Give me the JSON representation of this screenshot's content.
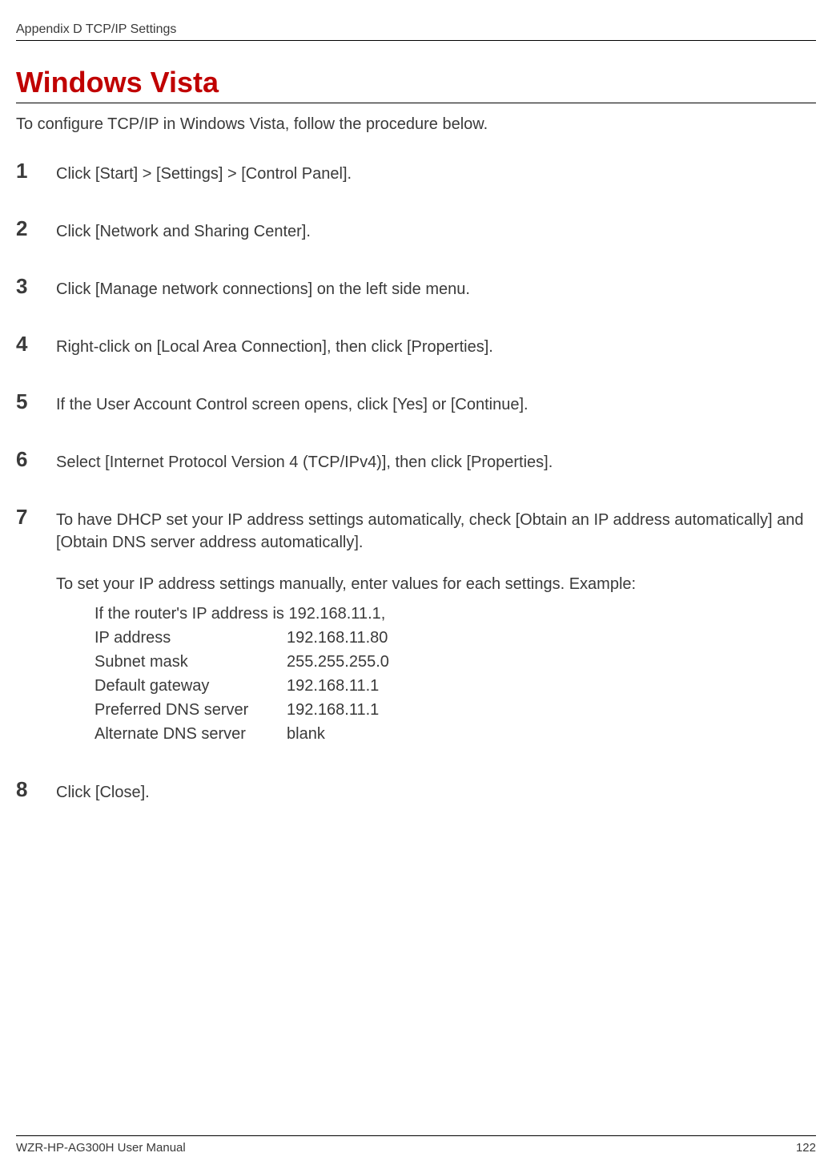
{
  "header": {
    "appendix_label": "Appendix D TCP/IP Settings"
  },
  "title": "Windows Vista",
  "intro": "To configure TCP/IP in Windows Vista, follow the procedure below.",
  "steps": [
    {
      "num": "1",
      "text": "Click [Start] > [Settings] > [Control Panel]."
    },
    {
      "num": "2",
      "text": "Click [Network and Sharing Center]."
    },
    {
      "num": "3",
      "text": "Click [Manage network connections] on the left side menu."
    },
    {
      "num": "4",
      "text": "Right-click on [Local Area Connection], then click [Properties]."
    },
    {
      "num": "5",
      "text": "If the User Account Control screen opens, click [Yes] or [Continue]."
    },
    {
      "num": "6",
      "text": "Select [Internet Protocol Version 4 (TCP/IPv4)], then click [Properties]."
    },
    {
      "num": "7",
      "text": "To have DHCP set your IP address settings automatically, check [Obtain an IP address automatically] and [Obtain DNS server address automatically].",
      "para2": "To set your IP address settings manually, enter values for each settings.  Example:",
      "example_intro": "If the router's IP address is 192.168.11.1,",
      "example": [
        {
          "label": "IP address",
          "value": "192.168.11.80"
        },
        {
          "label": "Subnet mask",
          "value": "255.255.255.0"
        },
        {
          "label": "Default gateway",
          "value": "192.168.11.1"
        },
        {
          "label": "Preferred DNS server",
          "value": "192.168.11.1"
        },
        {
          "label": "Alternate DNS server",
          "value": "blank"
        }
      ]
    },
    {
      "num": "8",
      "text": "Click [Close]."
    }
  ],
  "footer": {
    "left": "WZR-HP-AG300H User Manual",
    "right": "122"
  }
}
